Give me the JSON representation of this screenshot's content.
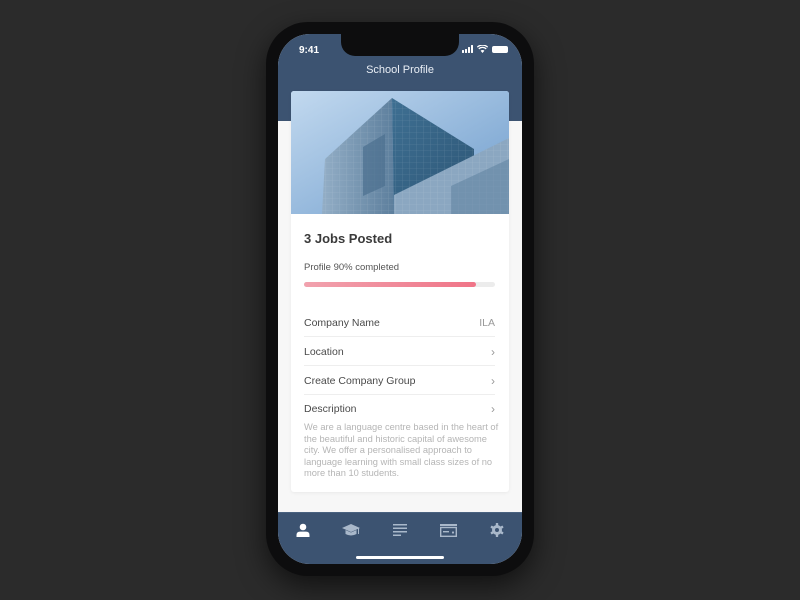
{
  "status_bar": {
    "time": "9:41",
    "icons": [
      "signal-icon",
      "wifi-icon",
      "battery-icon"
    ]
  },
  "header": {
    "title": "School Profile"
  },
  "hero": {
    "image": "office-building-photo"
  },
  "profile": {
    "jobs_posted": "3 Jobs Posted",
    "progress_label": "Profile 90% completed",
    "progress_percent": 90
  },
  "rows": [
    {
      "label": "Company Name",
      "value": "ILA",
      "chevron": false
    },
    {
      "label": "Location",
      "value": "",
      "chevron": true
    },
    {
      "label": "Create Company Group",
      "value": "",
      "chevron": true
    },
    {
      "label": "Description",
      "value": "",
      "chevron": true
    }
  ],
  "description": "We are a language centre based in the heart of the beautiful and historic capital of awesome city. We offer a personalised approach to language learning with small class sizes of no more than 10 students.",
  "tabbar": {
    "items": [
      {
        "name": "profile",
        "icon": "user-icon",
        "active": true
      },
      {
        "name": "education",
        "icon": "graduation-cap-icon",
        "active": false
      },
      {
        "name": "listings",
        "icon": "list-icon",
        "active": false
      },
      {
        "name": "payments",
        "icon": "card-icon",
        "active": false
      },
      {
        "name": "settings",
        "icon": "gear-icon",
        "active": false
      }
    ]
  },
  "colors": {
    "brand": "#3c5371",
    "progress": "#f07487",
    "background": "#2b2b2b"
  }
}
